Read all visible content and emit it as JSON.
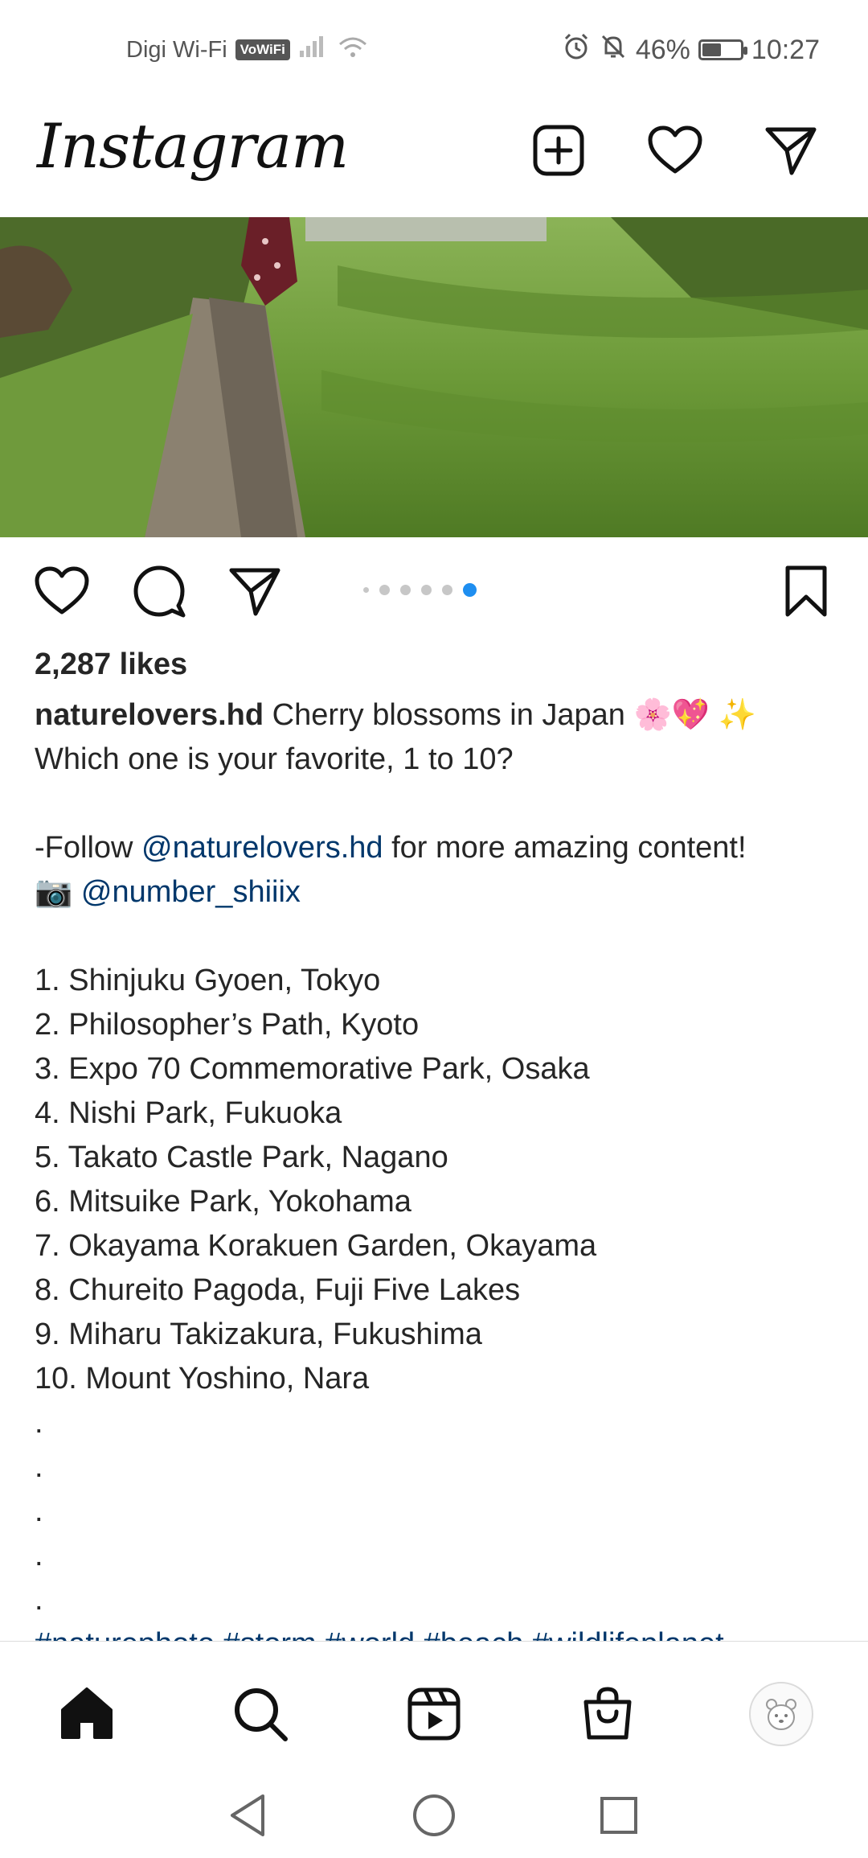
{
  "status_bar": {
    "carrier": "Digi Wi-Fi",
    "vowifi_badge": "VoWiFi",
    "battery_percent": "46%",
    "battery_level": 0.46,
    "time": "10:27"
  },
  "header": {
    "logo_text": "Instagram",
    "icons": [
      "new-post-icon",
      "heart-icon",
      "direct-message-icon"
    ]
  },
  "post": {
    "carousel": {
      "total_slides": 6,
      "active_index": 5
    },
    "likes": "2,287 likes",
    "username": "naturelovers.hd",
    "caption_first": "Cherry blossoms in Japan 🌸💖 ✨",
    "caption_question": "Which one is your favorite, 1 to 10?",
    "follow_prefix": "-Follow ",
    "follow_mention": "@naturelovers.hd",
    "follow_suffix": " for more amazing content!",
    "camera_emoji": "📷",
    "photo_mention": "@number_shiiix",
    "places": [
      "1. Shinjuku Gyoen, Tokyo",
      "2. Philosopher’s Path, Kyoto",
      "3. Expo 70 Commemorative Park, Osaka",
      "4. Nishi Park, Fukuoka",
      "5. Takato Castle Park, Nagano",
      "6. Mitsuike Park, Yokohama",
      "7. Okayama Korakuen Garden, Okayama",
      "8. Chureito Pagoda, Fuji Five Lakes",
      "9. Miharu Takizakura, Fukushima",
      "10. Mount Yoshino, Nara"
    ],
    "dots": [
      ".",
      ".",
      ".",
      ".",
      "."
    ],
    "hashtags": "#naturephoto #storm #world #beach #wildlifeplanet"
  },
  "bottom_nav": {
    "items": [
      "home-icon",
      "search-icon",
      "reels-icon",
      "shop-icon",
      "profile-avatar"
    ],
    "active": "home"
  },
  "colors": {
    "link": "#00376b",
    "accent": "#1e8ef0",
    "text": "#262626"
  }
}
